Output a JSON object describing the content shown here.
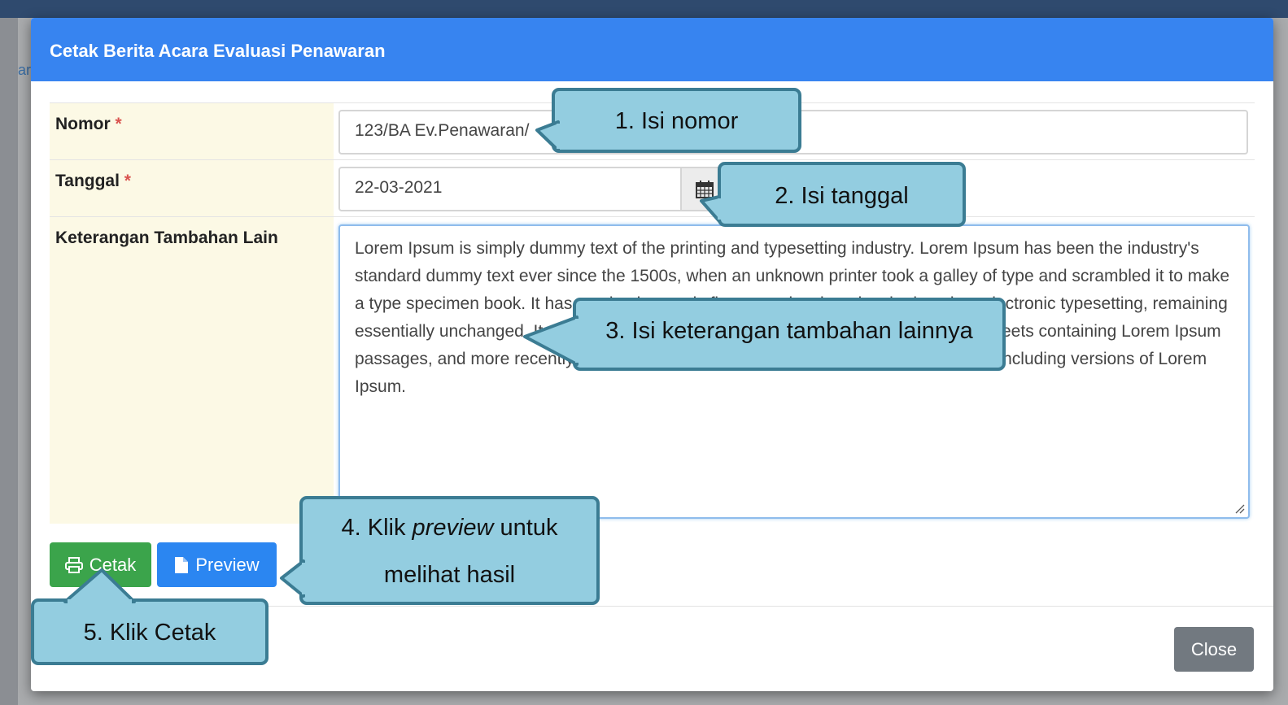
{
  "dialog": {
    "title": "Cetak Berita Acara Evaluasi Penawaran",
    "fields": {
      "nomor": {
        "label": "Nomor",
        "required_mark": "*",
        "value": "123/BA Ev.Penawaran/"
      },
      "tanggal": {
        "label": "Tanggal",
        "required_mark": "*",
        "value": "22-03-2021",
        "icon": "calendar-icon"
      },
      "keterangan": {
        "label": "Keterangan Tambahan Lain",
        "value": "Lorem Ipsum is simply dummy text of the printing and typesetting industry. Lorem Ipsum has been the industry's standard dummy text ever since the 1500s, when an unknown printer took a galley of type and scrambled it to make a type specimen book. It has survived not only five centuries, but also the leap into electronic typesetting, remaining essentially unchanged. It was popularised in the 1960s with the release of Letraset sheets containing Lorem Ipsum passages, and more recently with desktop publishing software like Aldus PageMaker including versions of Lorem Ipsum."
      }
    },
    "buttons": {
      "cetak": {
        "label": "Cetak",
        "icon": "print-icon",
        "color": "#3ba44b"
      },
      "preview": {
        "label": "Preview",
        "icon": "file-icon",
        "color": "#2b86f1"
      },
      "close": {
        "label": "Close",
        "color": "#727980"
      }
    },
    "header_color": "#3784f0"
  },
  "background": {
    "partial_text": "ar"
  },
  "callouts": {
    "c1": "1. Isi nomor",
    "c2": "2. Isi tanggal",
    "c3": "3. Isi keterangan tambahan lainnya",
    "c4_prefix": "4. Klik ",
    "c4_italic": "preview",
    "c4_suffix": " untuk",
    "c4_line2": "melihat hasil",
    "c5": "5. Klik Cetak"
  }
}
